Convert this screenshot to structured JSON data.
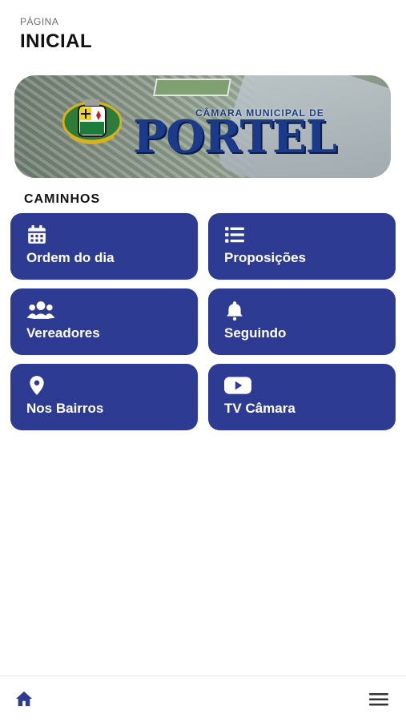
{
  "header": {
    "subtitle": "PÁGINA",
    "title": "INICIAL"
  },
  "banner": {
    "line1": "CÂMARA MUNICIPAL DE",
    "line2": "PORTEL"
  },
  "section": {
    "title": "CAMINHOS"
  },
  "cards": [
    {
      "label": "Ordem do dia",
      "icon": "calendar-icon"
    },
    {
      "label": "Proposições",
      "icon": "list-icon"
    },
    {
      "label": "Vereadores",
      "icon": "users-icon"
    },
    {
      "label": "Seguindo",
      "icon": "bell-icon"
    },
    {
      "label": "Nos Bairros",
      "icon": "location-pin-icon"
    },
    {
      "label": "TV Câmara",
      "icon": "video-play-icon"
    }
  ],
  "nav": {
    "home_icon": "home-icon",
    "menu_icon": "hamburger-menu-icon"
  },
  "colors": {
    "card_bg": "#2e3b93",
    "nav_icon": "#2e3b93"
  }
}
